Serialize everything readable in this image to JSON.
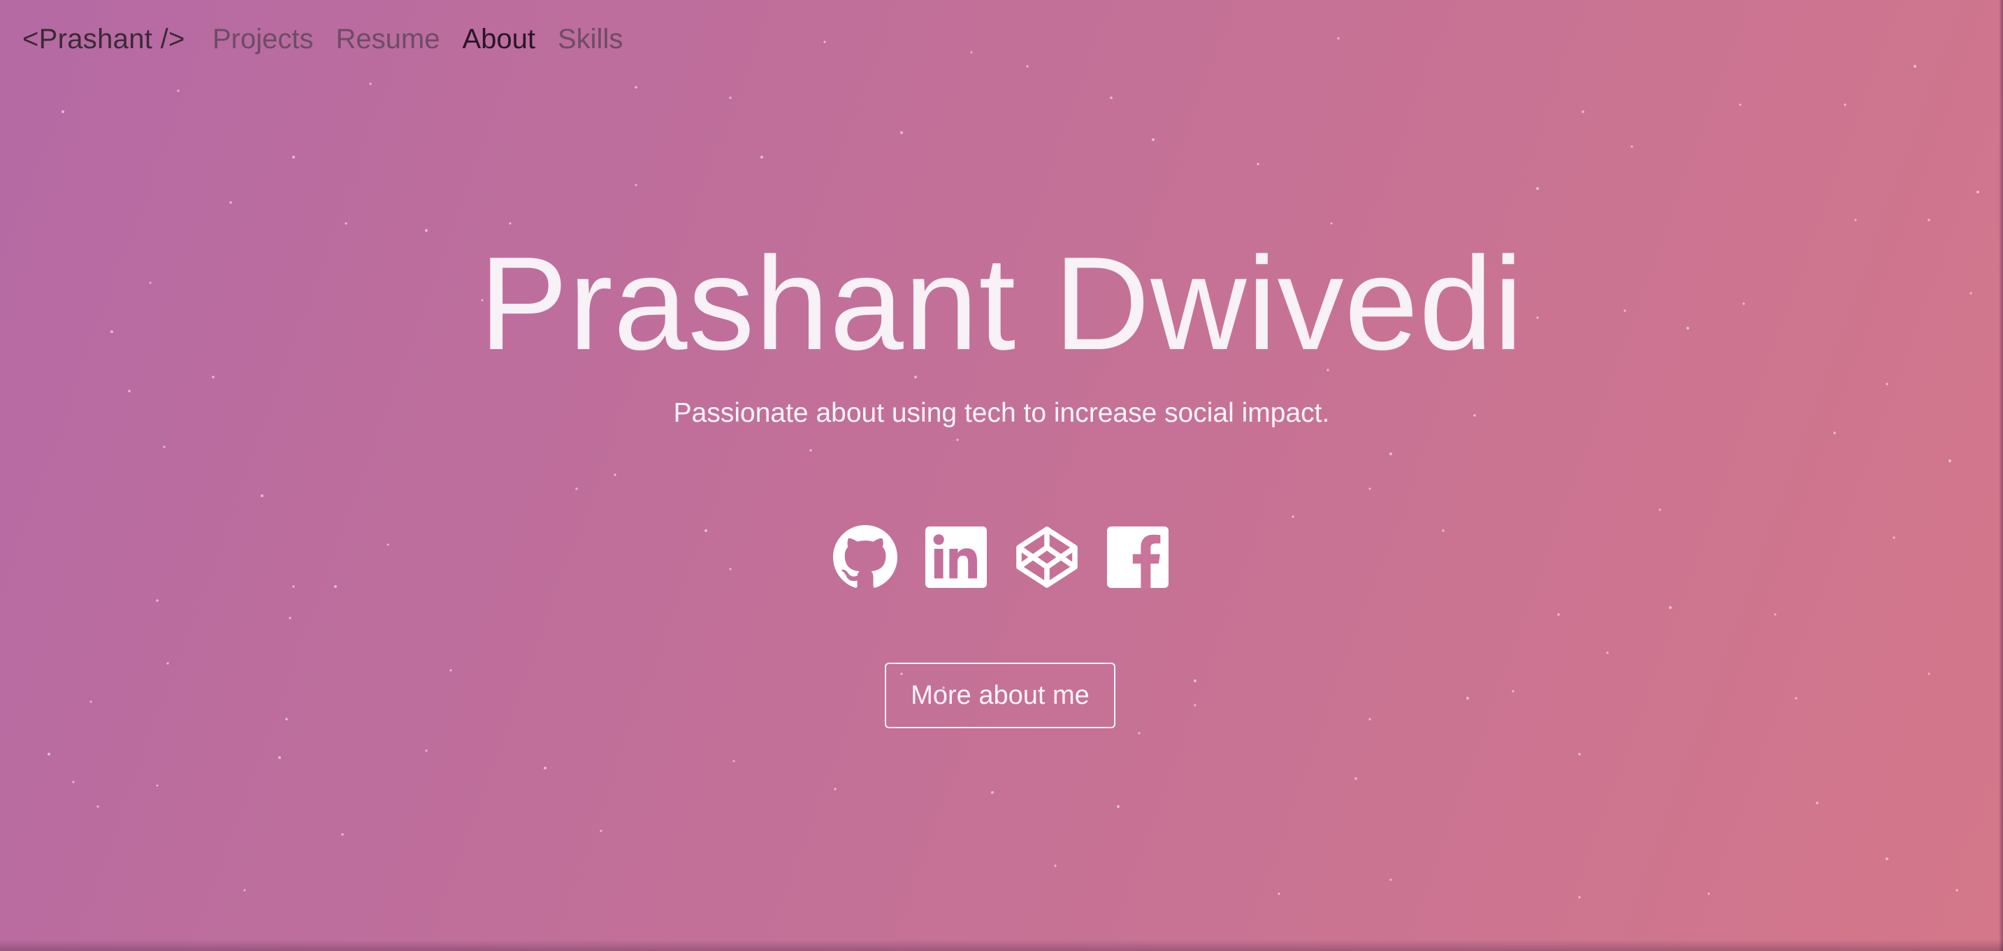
{
  "nav": {
    "brand": "<Prashant />",
    "links": [
      {
        "label": "Projects",
        "active": false
      },
      {
        "label": "Resume",
        "active": false
      },
      {
        "label": "About",
        "active": true
      },
      {
        "label": "Skills",
        "active": false
      }
    ]
  },
  "hero": {
    "title": "Prashant Dwivedi",
    "subtitle": "Passionate about using tech to increase social impact.",
    "cta_label": "More about me"
  },
  "social": [
    {
      "icon": "github-icon"
    },
    {
      "icon": "linkedin-icon"
    },
    {
      "icon": "codepen-icon"
    },
    {
      "icon": "facebook-icon"
    }
  ],
  "colors": {
    "gradient_start": "#b56aa4",
    "gradient_end": "#d4778a",
    "text_light": "#f8f1f6",
    "brand_text": "#3b2a36",
    "nav_text": "#6e4c65",
    "nav_active": "#2a1626"
  }
}
